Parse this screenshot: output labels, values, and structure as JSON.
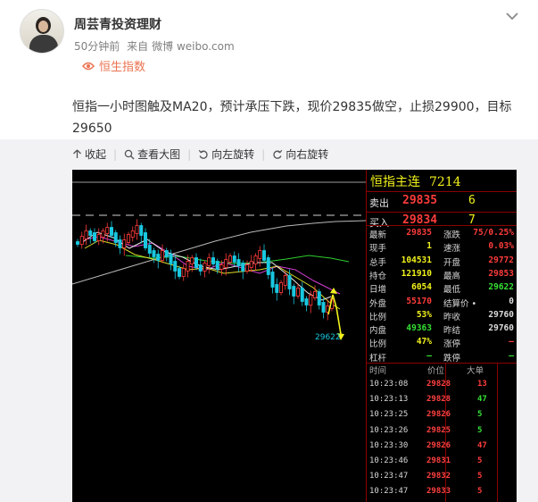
{
  "post": {
    "username": "周芸青投资理财",
    "time": "50分钟前",
    "source_prefix": "来自",
    "source": "微博 weibo.com",
    "topic": "恒生指数",
    "text_line1": "恒指一小时图触及MA20，预计承压下跌，现价29835做空，止损29900，目标",
    "text_line2": "29650"
  },
  "toolbar": {
    "collapse": "收起",
    "view_large": "查看大图",
    "rotate_left": "向左旋转",
    "rotate_right": "向右旋转"
  },
  "quote": {
    "title": "恒指主连",
    "code": "7214",
    "sell_label": "卖出",
    "sell_price": "29835",
    "sell_qty": "6",
    "buy_label": "买入",
    "buy_price": "29834",
    "buy_qty": "7",
    "left_stats": [
      {
        "k": "最新",
        "v": "29835",
        "c": "#ff3b3b"
      },
      {
        "k": "现手",
        "v": "1",
        "c": "#f2f21c"
      },
      {
        "k": "总手",
        "v": "104531",
        "c": "#f2f21c"
      },
      {
        "k": "持仓",
        "v": "121910",
        "c": "#f2f21c"
      },
      {
        "k": "日增",
        "v": "6054",
        "c": "#f2f21c"
      },
      {
        "k": "外盘",
        "v": "55170",
        "c": "#ff3b3b"
      },
      {
        "k": "比例",
        "v": "53%",
        "c": "#f2f21c"
      },
      {
        "k": "内盘",
        "v": "49363",
        "c": "#35e035"
      },
      {
        "k": "比例",
        "v": "47%",
        "c": "#f2f21c"
      },
      {
        "k": "杠杆",
        "v": "—",
        "c": "#35e035"
      }
    ],
    "right_stats": [
      {
        "k": "涨跌",
        "v": "75/0.25%",
        "c": "#ff3b3b"
      },
      {
        "k": "速涨",
        "v": "0.03%",
        "c": "#ff3b3b"
      },
      {
        "k": "开盘",
        "v": "29772",
        "c": "#ff3b3b"
      },
      {
        "k": "最高",
        "v": "29853",
        "c": "#ff3b3b"
      },
      {
        "k": "最低",
        "v": "29622",
        "c": "#35e035"
      },
      {
        "k": "结算价 •",
        "v": "0",
        "c": "#dcdcdc"
      },
      {
        "k": "昨收",
        "v": "29760",
        "c": "#dcdcdc"
      },
      {
        "k": "昨结",
        "v": "29760",
        "c": "#dcdcdc"
      },
      {
        "k": "涨停",
        "v": "—",
        "c": "#ff3b3b"
      },
      {
        "k": "跌停",
        "v": "—",
        "c": "#35e035"
      }
    ],
    "tick_headers": [
      "时间",
      "价位",
      "大单"
    ],
    "ticks": [
      {
        "t": "10:23:08",
        "p": "29828",
        "q": "13",
        "c": "#ff3b3b"
      },
      {
        "t": "10:23:13",
        "p": "29828",
        "q": "47",
        "c": "#35e035"
      },
      {
        "t": "10:23:25",
        "p": "29826",
        "q": "5",
        "c": "#35e035"
      },
      {
        "t": "10:23:26",
        "p": "29825",
        "q": "5",
        "c": "#35e035"
      },
      {
        "t": "10:23:30",
        "p": "29826",
        "q": "47",
        "c": "#ff3b3b"
      },
      {
        "t": "10:23:46",
        "p": "29831",
        "q": "5",
        "c": "#ff3b3b"
      },
      {
        "t": "10:23:47",
        "p": "29832",
        "q": "5",
        "c": "#ff3b3b"
      },
      {
        "t": "10:23:47",
        "p": "29833",
        "q": "5",
        "c": "#ff3b3b"
      }
    ]
  },
  "chart": {
    "low_label": "29622"
  },
  "colors": {
    "accent_orange": "#eb7350",
    "up_red": "#ff3b3b",
    "down_cyan": "#19c8e0",
    "value_yellow": "#f2f21c",
    "green": "#35e035"
  }
}
